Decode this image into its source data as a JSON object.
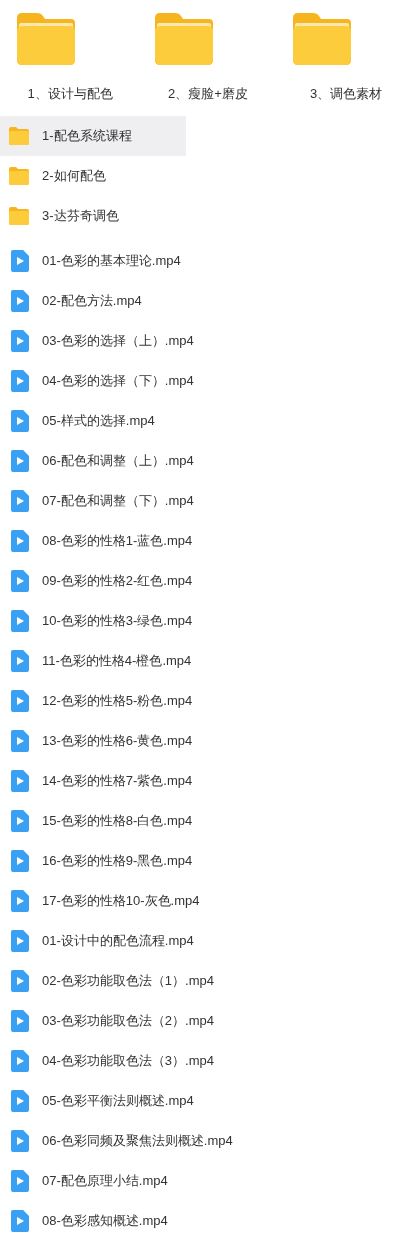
{
  "large_folders": [
    {
      "name": "1、设计与配色",
      "selected": false
    },
    {
      "name": "2、瘦脸+磨皮",
      "selected": false
    },
    {
      "name": "3、调色素材",
      "selected": false
    }
  ],
  "items": [
    {
      "kind": "folder",
      "name": "1-配色系统课程",
      "selected": true
    },
    {
      "kind": "folder",
      "name": "2-如何配色",
      "selected": false
    },
    {
      "kind": "folder",
      "name": "3-达芬奇调色",
      "selected": false
    },
    {
      "kind": "video",
      "name": "01-色彩的基本理论.mp4",
      "selected": false
    },
    {
      "kind": "video",
      "name": "02-配色方法.mp4",
      "selected": false
    },
    {
      "kind": "video",
      "name": "03-色彩的选择（上）.mp4",
      "selected": false
    },
    {
      "kind": "video",
      "name": "04-色彩的选择（下）.mp4",
      "selected": false
    },
    {
      "kind": "video",
      "name": "05-样式的选择.mp4",
      "selected": false
    },
    {
      "kind": "video",
      "name": "06-配色和调整（上）.mp4",
      "selected": false
    },
    {
      "kind": "video",
      "name": "07-配色和调整（下）.mp4",
      "selected": false
    },
    {
      "kind": "video",
      "name": "08-色彩的性格1-蓝色.mp4",
      "selected": false
    },
    {
      "kind": "video",
      "name": "09-色彩的性格2-红色.mp4",
      "selected": false
    },
    {
      "kind": "video",
      "name": "10-色彩的性格3-绿色.mp4",
      "selected": false
    },
    {
      "kind": "video",
      "name": "11-色彩的性格4-橙色.mp4",
      "selected": false
    },
    {
      "kind": "video",
      "name": "12-色彩的性格5-粉色.mp4",
      "selected": false
    },
    {
      "kind": "video",
      "name": "13-色彩的性格6-黄色.mp4",
      "selected": false
    },
    {
      "kind": "video",
      "name": "14-色彩的性格7-紫色.mp4",
      "selected": false
    },
    {
      "kind": "video",
      "name": "15-色彩的性格8-白色.mp4",
      "selected": false
    },
    {
      "kind": "video",
      "name": "16-色彩的性格9-黑色.mp4",
      "selected": false
    },
    {
      "kind": "video",
      "name": "17-色彩的性格10-灰色.mp4",
      "selected": false
    },
    {
      "kind": "video",
      "name": "01-设计中的配色流程.mp4",
      "selected": false
    },
    {
      "kind": "video",
      "name": "02-色彩功能取色法（1）.mp4",
      "selected": false
    },
    {
      "kind": "video",
      "name": "03-色彩功能取色法（2）.mp4",
      "selected": false
    },
    {
      "kind": "video",
      "name": "04-色彩功能取色法（3）.mp4",
      "selected": false
    },
    {
      "kind": "video",
      "name": "05-色彩平衡法则概述.mp4",
      "selected": false
    },
    {
      "kind": "video",
      "name": "06-色彩同频及聚焦法则概述.mp4",
      "selected": false
    },
    {
      "kind": "video",
      "name": "07-配色原理小结.mp4",
      "selected": false
    },
    {
      "kind": "video",
      "name": "08-色彩感知概述.mp4",
      "selected": false
    }
  ]
}
